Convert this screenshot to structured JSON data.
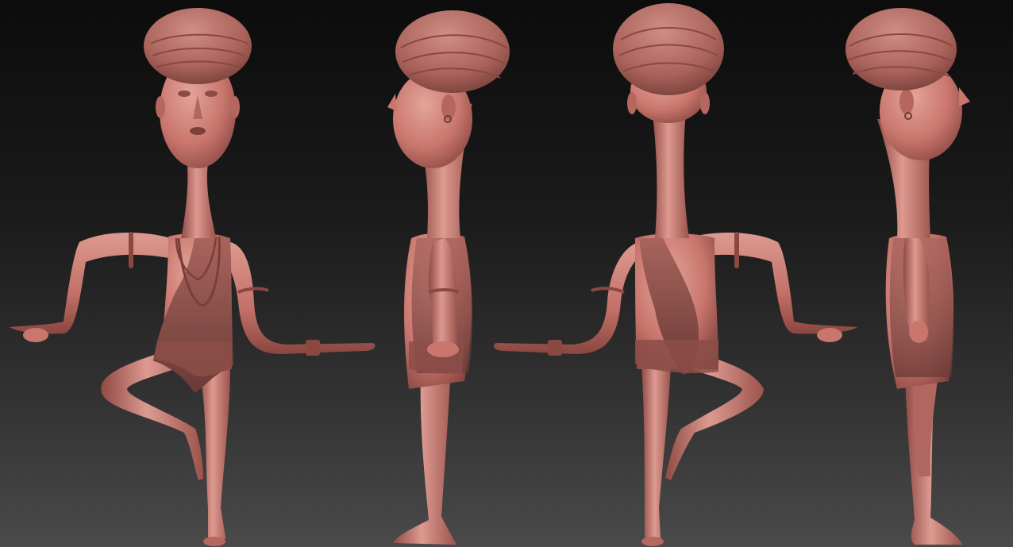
{
  "scene": {
    "subject": "sculpted-character-turnaround",
    "views": [
      {
        "name": "front"
      },
      {
        "name": "left-side"
      },
      {
        "name": "back"
      },
      {
        "name": "right-side"
      }
    ],
    "colors": {
      "skin": "#c9766d",
      "skin_light": "#e3a49a",
      "skin_dark": "#7d3f39",
      "cloth": "#9a5a54",
      "cloth_dark": "#6b3a36",
      "hair": "#b06a62",
      "background_top": "#0c0c0c",
      "background_bottom": "#4a4a4a"
    }
  }
}
